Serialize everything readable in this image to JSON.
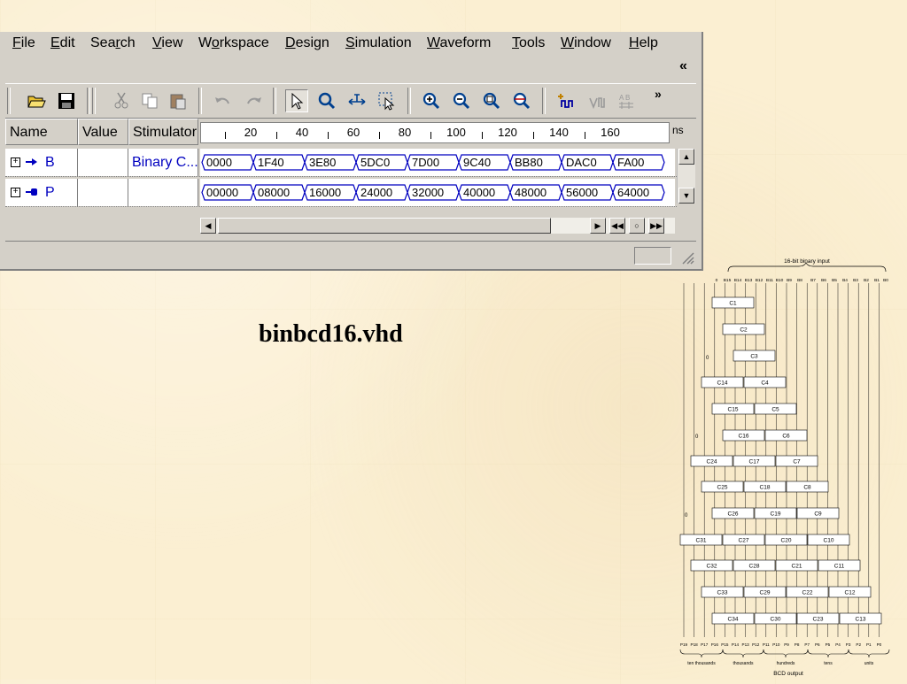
{
  "menu": [
    {
      "label": "File",
      "hotkey_index": 0
    },
    {
      "label": "Edit",
      "hotkey_index": 0
    },
    {
      "label": "Search",
      "hotkey_index": 3
    },
    {
      "label": "View",
      "hotkey_index": 0
    },
    {
      "label": "Workspace",
      "hotkey_index": 1
    },
    {
      "label": "Design",
      "hotkey_index": 0
    },
    {
      "label": "Simulation",
      "hotkey_index": 0
    },
    {
      "label": "Waveform",
      "hotkey_index": 0
    },
    {
      "label": "Tools",
      "hotkey_index": 0
    },
    {
      "label": "Window",
      "hotkey_index": 0
    },
    {
      "label": "Help",
      "hotkey_index": 0
    }
  ],
  "menu_collapse": "«",
  "toolbar": {
    "more": "»",
    "icons": [
      "open-folder-icon",
      "save-icon",
      "cut-icon",
      "copy-icon",
      "paste-icon",
      "undo-icon",
      "redo-icon",
      "select-pointer-icon",
      "zoom-icon",
      "measure-icon",
      "select-region-icon",
      "zoom-in-icon",
      "zoom-out-icon",
      "zoom-fit-icon",
      "zoom-full-icon",
      "add-signal-icon",
      "waveform-edit-icon",
      "bus-signal-icon"
    ]
  },
  "waveform": {
    "headers": {
      "name": "Name",
      "value": "Value",
      "stimulator": "Stimulator"
    },
    "unit": "ns",
    "ruler_ticks": [
      "20",
      "40",
      "60",
      "80",
      "100",
      "120",
      "140",
      "160"
    ],
    "signals": [
      {
        "name": "B",
        "direction": "input",
        "value": "",
        "stimulator": "Binary C...",
        "segments": [
          "0000",
          "1F40",
          "3E80",
          "5DC0",
          "7D00",
          "9C40",
          "BB80",
          "DAC0",
          "FA00"
        ]
      },
      {
        "name": "P",
        "direction": "output",
        "value": "",
        "stimulator": "",
        "segments": [
          "00000",
          "08000",
          "16000",
          "24000",
          "32000",
          "40000",
          "48000",
          "56000",
          "64000"
        ]
      }
    ]
  },
  "file_title": "binbcd16.vhd",
  "diagram": {
    "input_label": "16-bit binary input",
    "output_label": "BCD output",
    "input_bits": [
      "0",
      "B15",
      "B14",
      "B13",
      "B12",
      "B11",
      "B10",
      "B9",
      "B8",
      "B7",
      "B6",
      "B5",
      "B4",
      "B3",
      "B2",
      "B1",
      "B0"
    ],
    "zero_inputs": [
      "0",
      "0",
      "0",
      "0"
    ],
    "cells": [
      "C1",
      "C2",
      "C3",
      "C14",
      "C4",
      "C15",
      "C5",
      "C16",
      "C6",
      "C24",
      "C17",
      "C7",
      "C25",
      "C18",
      "C8",
      "C26",
      "C19",
      "C9",
      "C31",
      "C27",
      "C20",
      "C10",
      "C32",
      "C28",
      "C21",
      "C11",
      "C33",
      "C29",
      "C22",
      "C12",
      "C34",
      "C30",
      "C23",
      "C13"
    ],
    "output_bits": [
      "P19",
      "P18",
      "P17",
      "P16",
      "P15",
      "P14",
      "P13",
      "P12",
      "P11",
      "P10",
      "P9",
      "P8",
      "P7",
      "P6",
      "P5",
      "P4",
      "P3",
      "P2",
      "P1",
      "P0"
    ],
    "groups": [
      "ten thousands",
      "thousands",
      "hundreds",
      "tens",
      "units"
    ]
  },
  "colors": {
    "window_bg": "#d4d0c8",
    "signal_name": "#0000c0",
    "slide_bg": "#fbefd2"
  }
}
